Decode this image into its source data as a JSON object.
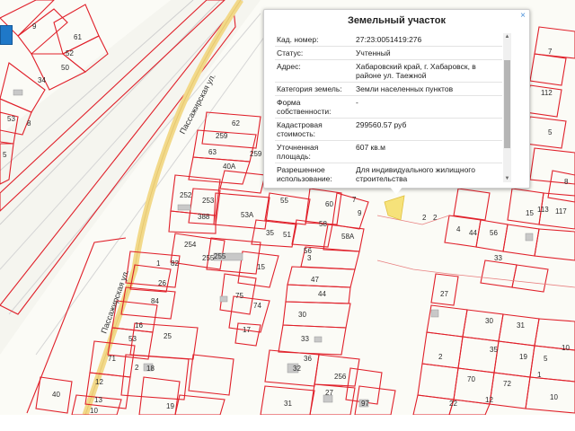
{
  "map": {
    "streets": [
      "Пассажирская ул.",
      "Пассажирская ул."
    ],
    "plot_numbers": [
      "9",
      "61",
      "52",
      "50",
      "34",
      "53",
      "8",
      "5",
      "62",
      "259",
      "63",
      "40А",
      "259",
      "255",
      "253",
      "252",
      "388",
      "53А",
      "55",
      "60",
      "9",
      "7",
      "58",
      "58А",
      "35",
      "51",
      "56",
      "3",
      "47",
      "44",
      "254",
      "255",
      "15",
      "1",
      "82",
      "84",
      "26",
      "53",
      "25",
      "75",
      "74",
      "17",
      "16",
      "71",
      "18",
      "12",
      "2",
      "13",
      "10",
      "19",
      "40",
      "32",
      "33",
      "30",
      "36",
      "31",
      "27",
      "97",
      "256",
      "2",
      "4",
      "44",
      "56",
      "33",
      "27",
      "15",
      "113",
      "112",
      "117",
      "2",
      "5",
      "7",
      "8",
      "30",
      "31",
      "35",
      "19",
      "5",
      "10",
      "2",
      "70",
      "72",
      "1",
      "12",
      "22",
      "10"
    ]
  },
  "popup": {
    "title": "Земельный участок",
    "close_icon": "×",
    "rows": [
      {
        "label": "Кад. номер:",
        "value": "27:23:0051419:276"
      },
      {
        "label": "Статус:",
        "value": "Учтенный"
      },
      {
        "label": "Адрес:",
        "value": "Хабаровский край, г. Хабаровск, в районе ул. Таежной"
      },
      {
        "label": "Категория земель:",
        "value": "Земли населенных пунктов"
      },
      {
        "label": "Форма собственности:",
        "value": "-"
      },
      {
        "label": "Кадастровая стоимость:",
        "value": "299560.57 руб"
      },
      {
        "label": "Уточненная площадь:",
        "value": "607 кв.м"
      },
      {
        "label": "Разрешенное использование:",
        "value": "Для индивидуального жилищного строительства"
      }
    ]
  },
  "colors": {
    "plot_border": "#e0202a",
    "road": "#f2d98a",
    "layer_button": "#1f78c8"
  }
}
